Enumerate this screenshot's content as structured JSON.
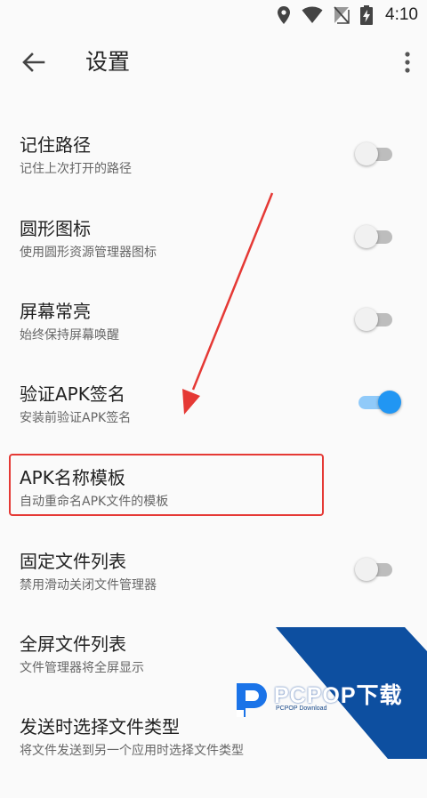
{
  "status_bar": {
    "time": "4:10",
    "icons": [
      "location-icon",
      "wifi-icon",
      "no-sim-icon",
      "battery-charging-icon"
    ]
  },
  "toolbar": {
    "back_icon": "arrow-left-icon",
    "title": "设置",
    "more_icon": "more-vert-icon"
  },
  "settings": [
    {
      "title": "记住路径",
      "subtitle": "记住上次打开的路径",
      "toggle": "off"
    },
    {
      "title": "圆形图标",
      "subtitle": "使用圆形资源管理器图标",
      "toggle": "off"
    },
    {
      "title": "屏幕常亮",
      "subtitle": "始终保持屏幕唤醒",
      "toggle": "off"
    },
    {
      "title": "验证APK签名",
      "subtitle": "安装前验证APK签名",
      "toggle": "on"
    },
    {
      "title": "APK名称模板",
      "subtitle": "自动重命名APK文件的模板"
    },
    {
      "title": "固定文件列表",
      "subtitle": "禁用滑动关闭文件管理器",
      "toggle": "off"
    },
    {
      "title": "全屏文件列表",
      "subtitle": "文件管理器将全屏显示"
    },
    {
      "title": "发送时选择文件类型",
      "subtitle": "将文件发送到另一个应用时选择文件类型"
    }
  ],
  "colors": {
    "accent": "#2196f3",
    "accent_track": "#90caf9",
    "annotation_red": "#e53935",
    "watermark_blue": "#0d4fa0"
  },
  "watermark": {
    "brand": "PCPOP下载",
    "sub": "PCPOP Download"
  }
}
